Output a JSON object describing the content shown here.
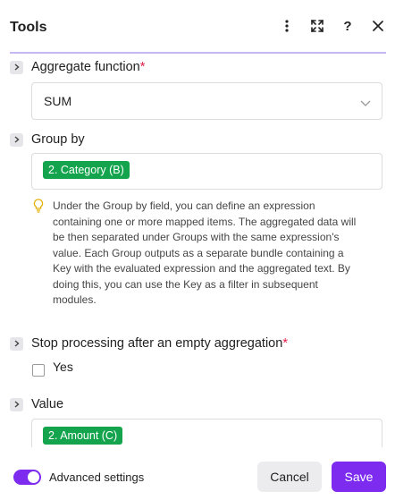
{
  "header": {
    "title": "Tools",
    "icons": [
      "more-vertical-icon",
      "expand-icon",
      "help-icon",
      "close-icon"
    ]
  },
  "fields": {
    "aggregate_function": {
      "label": "Aggregate function",
      "required_mark": "*",
      "value": "SUM"
    },
    "group_by": {
      "label": "Group by",
      "pill": "2. Category (B)",
      "hint": "Under the Group by field, you can define an expression containing one or more mapped items. The aggregated data will be then separated under Groups with the same expression's value. Each Group outputs as a separate bundle containing a Key with the evaluated expression and the aggregated text. By doing this, you can use the Key as a filter in subsequent modules."
    },
    "stop_processing": {
      "label": "Stop processing after an empty aggregation",
      "required_mark": "*",
      "checkbox_label": "Yes",
      "checked": false
    },
    "value": {
      "label": "Value",
      "pill": "2. Amount (C)"
    }
  },
  "footer": {
    "advanced_settings_label": "Advanced settings",
    "advanced_settings_on": true,
    "cancel_label": "Cancel",
    "save_label": "Save"
  },
  "colors": {
    "accent": "#7c2bef",
    "pill": "#14a44d",
    "required": "#e11d48",
    "header_rule": "#c6b8f2"
  }
}
